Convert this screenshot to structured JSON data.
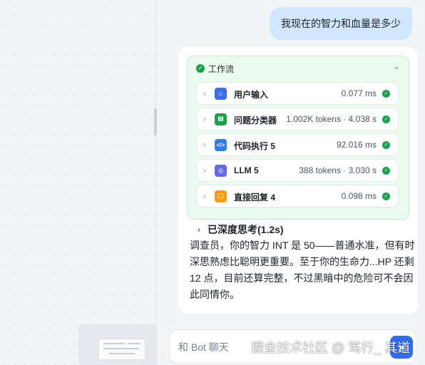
{
  "user_message": "我现在的智力和血量是多少",
  "workflow": {
    "title": "工作流",
    "steps": [
      {
        "name": "用户输入",
        "meta": "0.077 ms",
        "icon": "home-icon",
        "color": "#3b6cf6"
      },
      {
        "name": "问题分类器",
        "meta": "1.002K tokens · 4.038 s",
        "icon": "classifier-icon",
        "color": "#16a34a"
      },
      {
        "name": "代码执行 5",
        "meta": "92.016 ms",
        "icon": "code-icon",
        "color": "#2f7df6"
      },
      {
        "name": "LLM 5",
        "meta": "388 tokens · 3.030 s",
        "icon": "llm-icon",
        "color": "#6366f1"
      },
      {
        "name": "直接回复 4",
        "meta": "0.098 ms",
        "icon": "reply-icon",
        "color": "#f59e0b"
      }
    ]
  },
  "thinking": {
    "label": "已深度思考(1.2s)"
  },
  "answer": "调查员，你的智力 INT 是 50——普通水准，但有时深思熟虑比聪明更重要。至于你的生命力...HP 还剩 12 点，目前还算完整，不过黑暗中的危险可不会因此同情你。",
  "input": {
    "placeholder": "和 Bot 聊天"
  },
  "watermark": "掘金技术社区 @ 笃行_ 其道"
}
